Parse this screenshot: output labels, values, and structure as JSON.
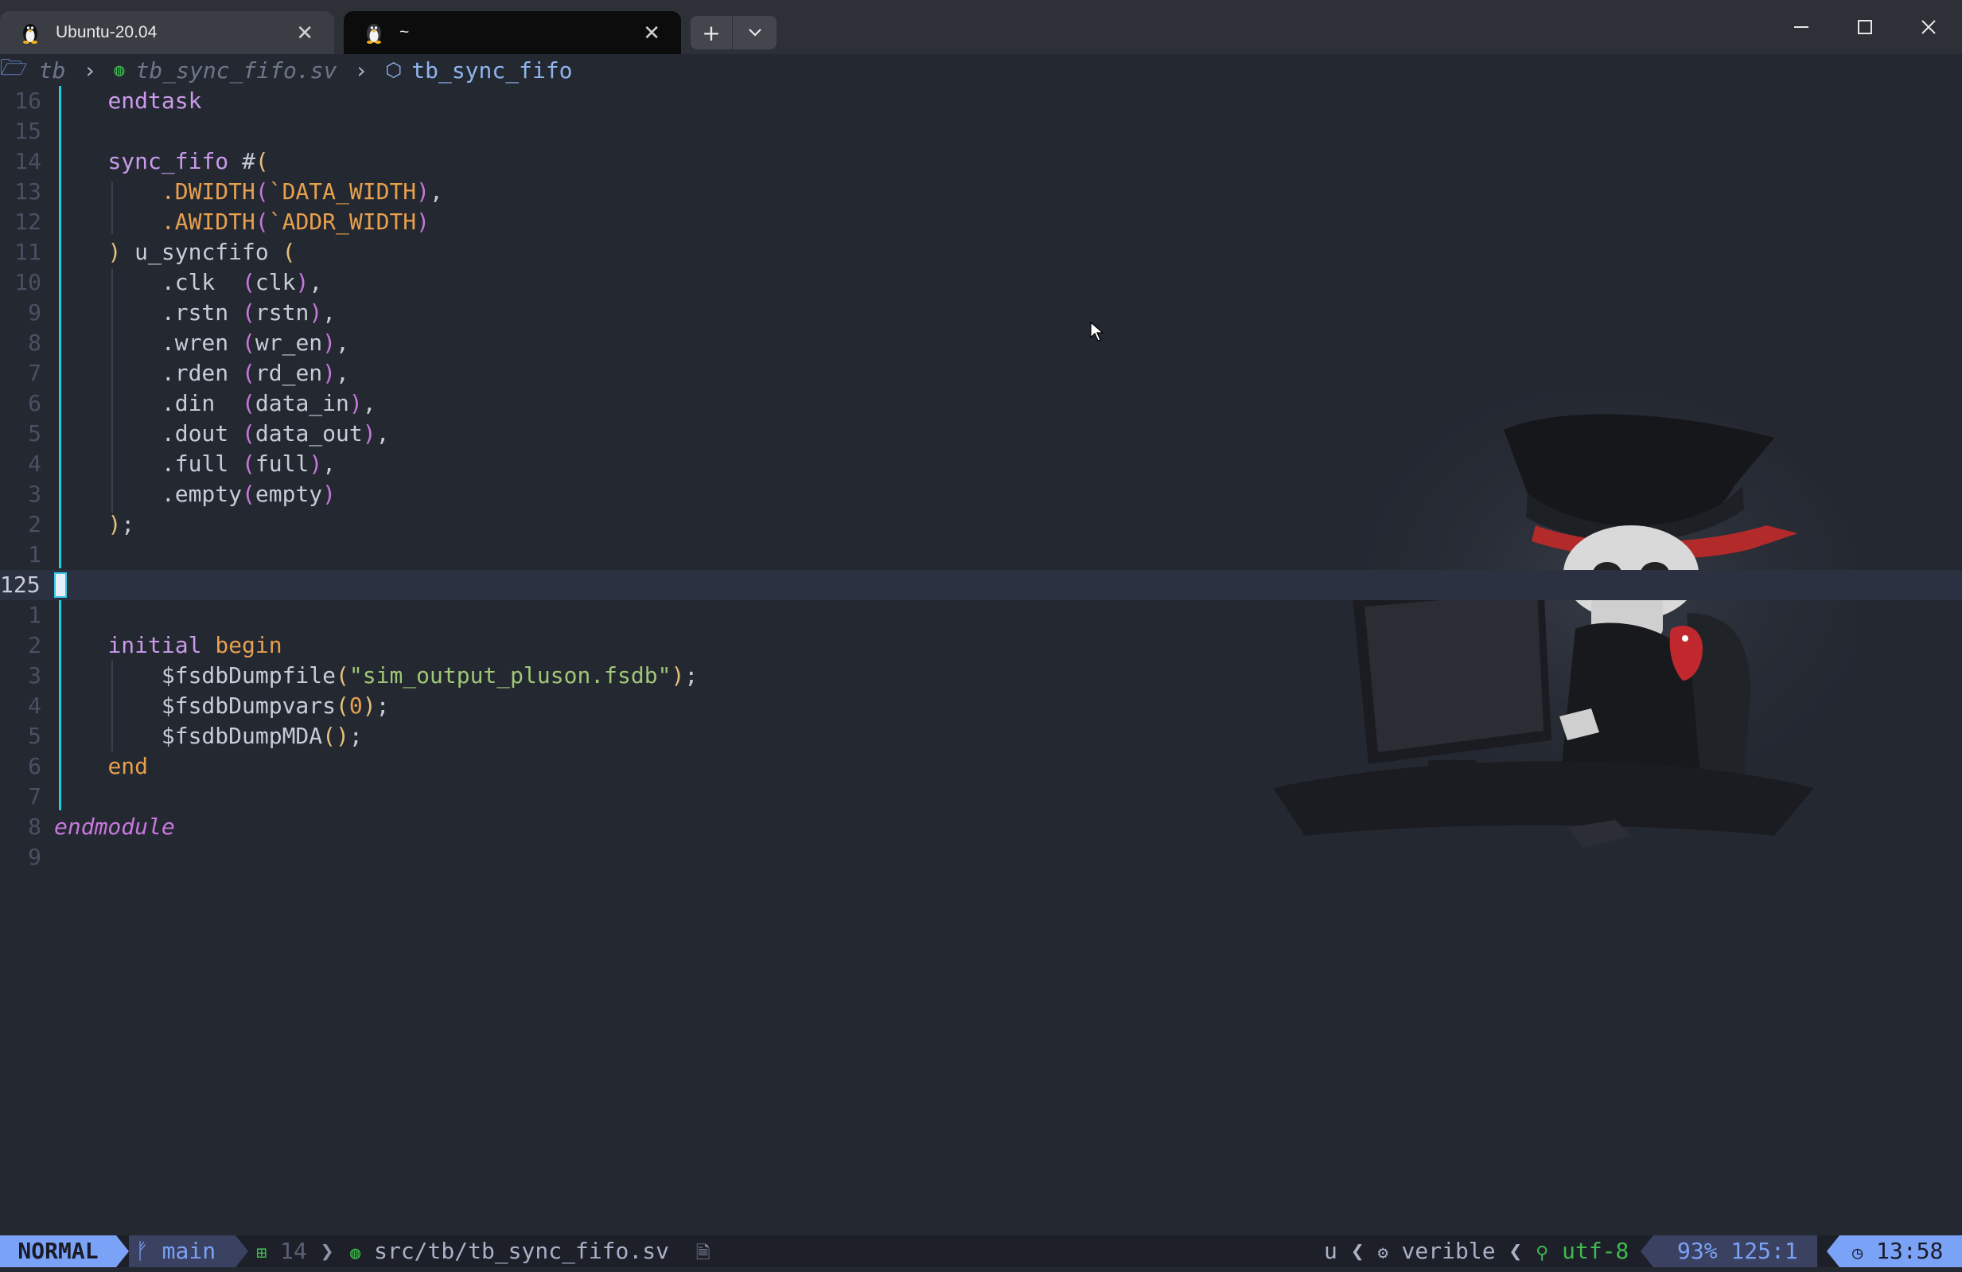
{
  "tabs": [
    {
      "label": "Ubuntu-20.04",
      "close": "✕",
      "icon": "linux-penguin-icon"
    },
    {
      "label": "~",
      "close": "✕",
      "icon": "linux-penguin-icon"
    }
  ],
  "tab_actions": {
    "new_tab": "+",
    "dropdown": "⌄"
  },
  "window_controls": {
    "minimize": "—",
    "maximize": "☐",
    "close": "✕"
  },
  "breadcrumb": {
    "folder_icon": "🗁",
    "folder": "tb",
    "sep1": "›",
    "file_icon": "◍",
    "file": "tb_sync_fifo.sv",
    "sep2": "›",
    "module_icon": "⬡",
    "module": "tb_sync_fifo"
  },
  "lines": [
    {
      "num": "16",
      "code": [
        {
          "t": "    "
        },
        {
          "t": "endtask",
          "c": "kw"
        }
      ]
    },
    {
      "num": "15",
      "code": []
    },
    {
      "num": "14",
      "code": [
        {
          "t": "    "
        },
        {
          "t": "sync_fifo",
          "c": "kw"
        },
        {
          "t": " #",
          "c": "id"
        },
        {
          "t": "(",
          "c": "p1"
        }
      ]
    },
    {
      "num": "13",
      "code": [
        {
          "t": "        "
        },
        {
          "t": ".DWIDTH",
          "c": "port"
        },
        {
          "t": "(",
          "c": "p2"
        },
        {
          "t": "`DATA_WIDTH",
          "c": "mac"
        },
        {
          "t": ")",
          "c": "p2"
        },
        {
          "t": ",",
          "c": "id"
        }
      ]
    },
    {
      "num": "12",
      "code": [
        {
          "t": "        "
        },
        {
          "t": ".AWIDTH",
          "c": "port"
        },
        {
          "t": "(",
          "c": "p2"
        },
        {
          "t": "`ADDR_WIDTH",
          "c": "mac"
        },
        {
          "t": ")",
          "c": "p2"
        }
      ]
    },
    {
      "num": "11",
      "code": [
        {
          "t": "    "
        },
        {
          "t": ")",
          "c": "p1"
        },
        {
          "t": " u_syncfifo ",
          "c": "id"
        },
        {
          "t": "(",
          "c": "p1"
        }
      ]
    },
    {
      "num": "10",
      "code": [
        {
          "t": "        "
        },
        {
          "t": ".clk  ",
          "c": "id"
        },
        {
          "t": "(",
          "c": "p2"
        },
        {
          "t": "clk",
          "c": "id"
        },
        {
          "t": ")",
          "c": "p2"
        },
        {
          "t": ",",
          "c": "id"
        }
      ]
    },
    {
      "num": "9",
      "code": [
        {
          "t": "        "
        },
        {
          "t": ".rstn ",
          "c": "id"
        },
        {
          "t": "(",
          "c": "p2"
        },
        {
          "t": "rstn",
          "c": "id"
        },
        {
          "t": ")",
          "c": "p2"
        },
        {
          "t": ",",
          "c": "id"
        }
      ]
    },
    {
      "num": "8",
      "code": [
        {
          "t": "        "
        },
        {
          "t": ".wren ",
          "c": "id"
        },
        {
          "t": "(",
          "c": "p2"
        },
        {
          "t": "wr_en",
          "c": "id"
        },
        {
          "t": ")",
          "c": "p2"
        },
        {
          "t": ",",
          "c": "id"
        }
      ]
    },
    {
      "num": "7",
      "code": [
        {
          "t": "        "
        },
        {
          "t": ".rden ",
          "c": "id"
        },
        {
          "t": "(",
          "c": "p2"
        },
        {
          "t": "rd_en",
          "c": "id"
        },
        {
          "t": ")",
          "c": "p2"
        },
        {
          "t": ",",
          "c": "id"
        }
      ]
    },
    {
      "num": "6",
      "code": [
        {
          "t": "        "
        },
        {
          "t": ".din  ",
          "c": "id"
        },
        {
          "t": "(",
          "c": "p2"
        },
        {
          "t": "data_in",
          "c": "id"
        },
        {
          "t": ")",
          "c": "p2"
        },
        {
          "t": ",",
          "c": "id"
        }
      ]
    },
    {
      "num": "5",
      "code": [
        {
          "t": "        "
        },
        {
          "t": ".dout ",
          "c": "id"
        },
        {
          "t": "(",
          "c": "p2"
        },
        {
          "t": "data_out",
          "c": "id"
        },
        {
          "t": ")",
          "c": "p2"
        },
        {
          "t": ",",
          "c": "id"
        }
      ]
    },
    {
      "num": "4",
      "code": [
        {
          "t": "        "
        },
        {
          "t": ".full ",
          "c": "id"
        },
        {
          "t": "(",
          "c": "p2"
        },
        {
          "t": "full",
          "c": "id"
        },
        {
          "t": ")",
          "c": "p2"
        },
        {
          "t": ",",
          "c": "id"
        }
      ]
    },
    {
      "num": "3",
      "code": [
        {
          "t": "        "
        },
        {
          "t": ".empty",
          "c": "id"
        },
        {
          "t": "(",
          "c": "p2"
        },
        {
          "t": "empty",
          "c": "id"
        },
        {
          "t": ")",
          "c": "p2"
        }
      ]
    },
    {
      "num": "2",
      "code": [
        {
          "t": "    "
        },
        {
          "t": ")",
          "c": "p1"
        },
        {
          "t": ";",
          "c": "id"
        }
      ]
    },
    {
      "num": "1",
      "code": []
    },
    {
      "num": "125",
      "code": [],
      "current": true
    },
    {
      "num": "1",
      "code": []
    },
    {
      "num": "2",
      "code": [
        {
          "t": "    "
        },
        {
          "t": "initial",
          "c": "kw"
        },
        {
          "t": " "
        },
        {
          "t": "begin",
          "c": "ctl"
        }
      ]
    },
    {
      "num": "3",
      "code": [
        {
          "t": "        "
        },
        {
          "t": "$fsdbDumpfile",
          "c": "sys"
        },
        {
          "t": "(",
          "c": "p1"
        },
        {
          "t": "\"sim_output_pluson.fsdb\"",
          "c": "str"
        },
        {
          "t": ")",
          "c": "p1"
        },
        {
          "t": ";",
          "c": "id"
        }
      ]
    },
    {
      "num": "4",
      "code": [
        {
          "t": "        "
        },
        {
          "t": "$fsdbDumpvars",
          "c": "sys"
        },
        {
          "t": "(",
          "c": "p1"
        },
        {
          "t": "0",
          "c": "num"
        },
        {
          "t": ")",
          "c": "p1"
        },
        {
          "t": ";",
          "c": "id"
        }
      ]
    },
    {
      "num": "5",
      "code": [
        {
          "t": "        "
        },
        {
          "t": "$fsdbDumpMDA",
          "c": "sys"
        },
        {
          "t": "()",
          "c": "p1"
        },
        {
          "t": ";",
          "c": "id"
        }
      ]
    },
    {
      "num": "6",
      "code": [
        {
          "t": "    "
        },
        {
          "t": "end",
          "c": "ctl"
        }
      ]
    },
    {
      "num": "7",
      "code": []
    },
    {
      "num": "8",
      "code": [
        {
          "t": "endmodule",
          "c": "em"
        }
      ]
    },
    {
      "num": "9",
      "code": []
    }
  ],
  "statusline": {
    "mode": "NORMAL",
    "branch_icon": "ᚠ",
    "branch": "main",
    "diag_icon": "⊞",
    "diag_count": "14",
    "chevron": "❯",
    "file_icon": "◍",
    "file": "src/tb/tb_sync_fifo.sv",
    "file_badge_icon": "🗎",
    "filetype": "u",
    "lsp_icon": "⚙",
    "lsp": "verible",
    "encoding_icon": "⚲",
    "encoding": "utf-8",
    "position": "93% 125:1",
    "clock_icon": "◷",
    "time": "13:58"
  }
}
